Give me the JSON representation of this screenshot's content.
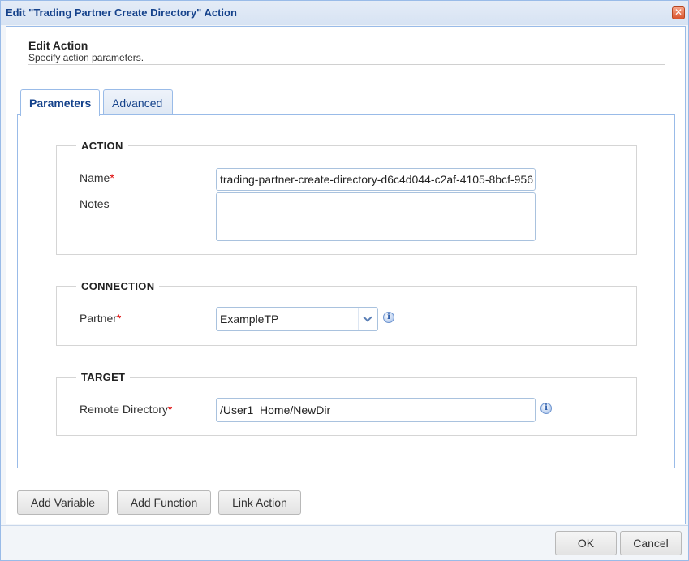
{
  "dialog": {
    "title": "Edit \"Trading Partner Create Directory\" Action",
    "close_glyph": "✕"
  },
  "header": {
    "title": "Edit Action",
    "subtitle": "Specify action parameters."
  },
  "tabs": [
    {
      "label": "Parameters",
      "active": true
    },
    {
      "label": "Advanced",
      "active": false
    }
  ],
  "sections": {
    "action": {
      "legend": "ACTION",
      "name_label": "Name",
      "name_value": "trading-partner-create-directory-d6c4d044-c2af-4105-8bcf-956",
      "notes_label": "Notes",
      "notes_value": ""
    },
    "connection": {
      "legend": "CONNECTION",
      "partner_label": "Partner",
      "partner_value": "ExampleTP"
    },
    "target": {
      "legend": "TARGET",
      "remote_dir_label": "Remote Directory",
      "remote_dir_value": "/User1_Home/NewDir"
    }
  },
  "required_marker": "*",
  "icons": {
    "info_glyph": "i"
  },
  "toolbar": {
    "add_variable": "Add Variable",
    "add_function": "Add Function",
    "link_action": "Link Action"
  },
  "footer": {
    "ok": "OK",
    "cancel": "Cancel"
  }
}
